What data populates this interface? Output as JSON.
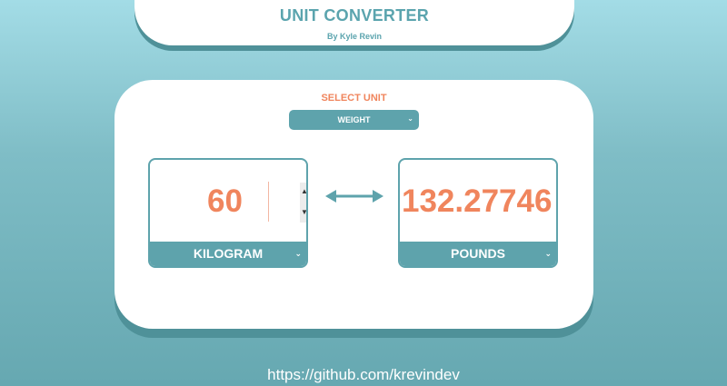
{
  "header": {
    "title": "UNIT CONVERTER",
    "author": "By Kyle Revin"
  },
  "selector": {
    "label": "SELECT UNIT",
    "selected": "WEIGHT"
  },
  "converter": {
    "left": {
      "value": "60",
      "unit": "KILOGRAM"
    },
    "right": {
      "value": "132.27746",
      "unit": "POUNDS"
    }
  },
  "icons": {
    "chevron": "⌄",
    "spin_up": "▲",
    "spin_down": "▼"
  },
  "footer": {
    "link_text": "https://github.com/krevindev"
  },
  "colors": {
    "accent": "#5ea3ac",
    "value": "#f0855d",
    "card": "#ffffff"
  }
}
